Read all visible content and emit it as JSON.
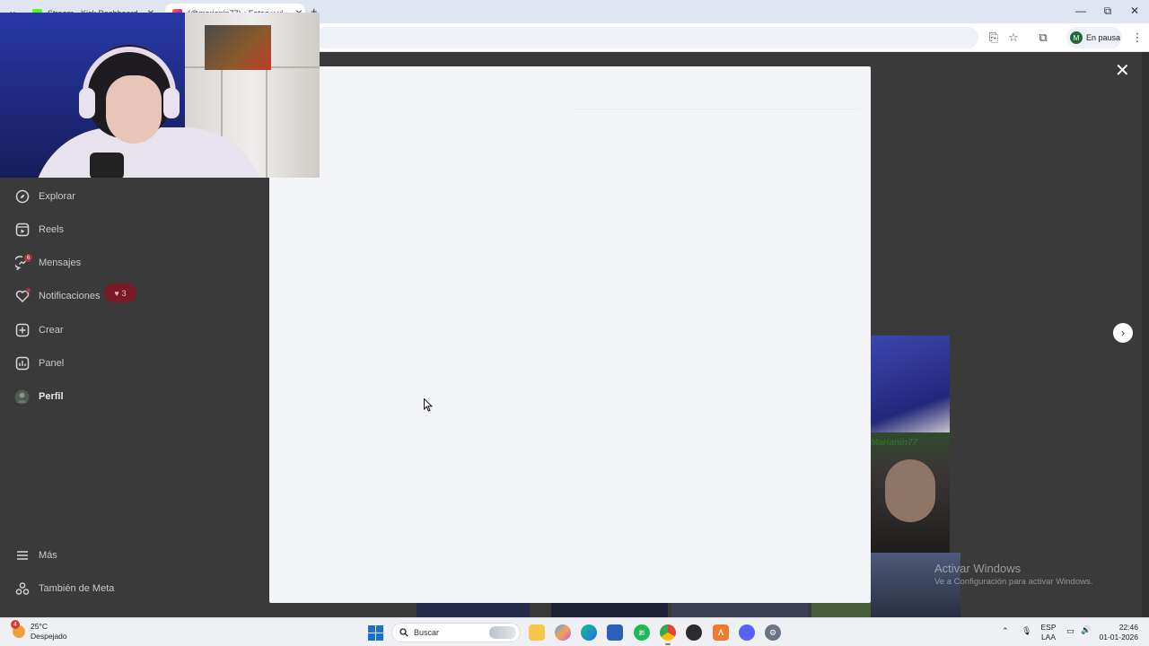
{
  "browser": {
    "tabs": [
      {
        "title": "Stream - Kick Dashboard",
        "favicon_color": "#53fc18"
      },
      {
        "title": "(@marianin77) • Fotos y vi...",
        "favicon_color": "#d6249f"
      }
    ],
    "new_tab_symbol": "+",
    "profile": {
      "initial": "M",
      "status": "En pausa"
    },
    "window_controls": {
      "minimize": "—",
      "restore": "⧉",
      "close": "✕"
    }
  },
  "sidebar": {
    "items": [
      {
        "id": "explorar",
        "label": "Explorar",
        "icon": "compass-icon"
      },
      {
        "id": "reels",
        "label": "Reels",
        "icon": "reels-icon"
      },
      {
        "id": "mensajes",
        "label": "Mensajes",
        "icon": "messenger-icon",
        "badge": "6"
      },
      {
        "id": "notificaciones",
        "label": "Notificaciones",
        "icon": "heart-icon",
        "badge": "3"
      },
      {
        "id": "crear",
        "label": "Crear",
        "icon": "plus-square-icon"
      },
      {
        "id": "panel",
        "label": "Panel",
        "icon": "chart-icon"
      },
      {
        "id": "perfil",
        "label": "Perfil",
        "icon": "avatar-icon"
      }
    ],
    "bottom": [
      {
        "id": "mas",
        "label": "Más",
        "icon": "menu-icon"
      },
      {
        "id": "meta",
        "label": "También de Meta",
        "icon": "meta-icon"
      }
    ]
  },
  "background_post": {
    "overlay_name": "Marianin77"
  },
  "watermark": {
    "title": "Activar Windows",
    "subtitle": "Ve a Configuración para activar Windows."
  },
  "taskbar": {
    "weather": {
      "temp": "25°C",
      "condition": "Despejado",
      "badge": "4"
    },
    "search_placeholder": "Buscar",
    "lang": {
      "line1": "ESP",
      "line2": "LAA"
    },
    "time": "22:46",
    "date": "01-01-2026"
  },
  "colors": {
    "dim_bg": "#3a3a3a",
    "modal_bg": "#f3f4f7",
    "badge_red": "#7a1a25"
  }
}
